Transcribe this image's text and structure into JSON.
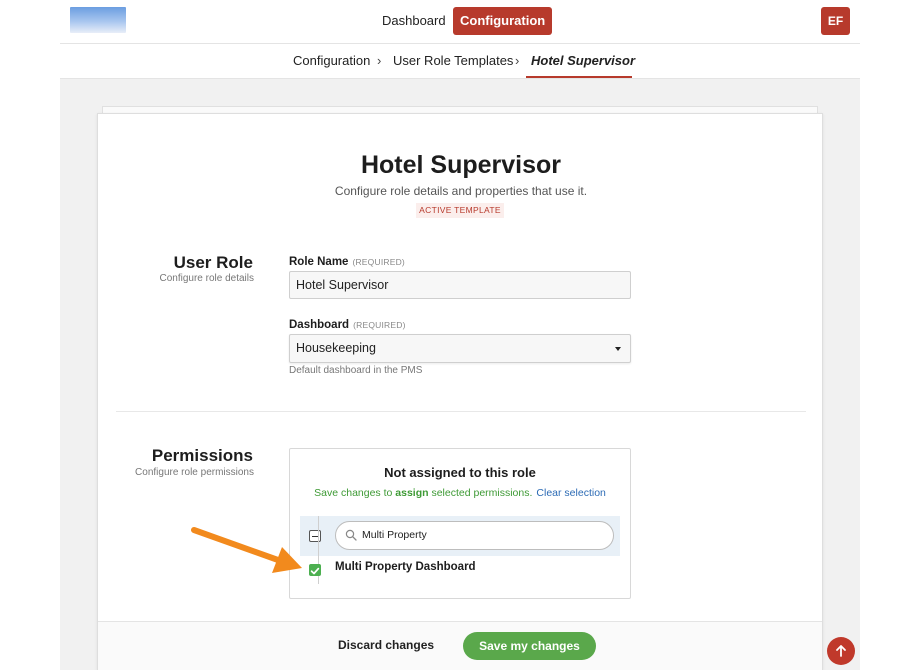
{
  "nav": {
    "dashboard": "Dashboard",
    "configuration": "Configuration",
    "user_initials": "EF"
  },
  "breadcrumb": {
    "items": [
      "Configuration",
      "User Role Templates",
      "Hotel Supervisor"
    ],
    "separator": "›"
  },
  "header": {
    "title": "Hotel Supervisor",
    "subtitle": "Configure role details and properties that use it.",
    "badge": "ACTIVE TEMPLATE"
  },
  "user_role": {
    "title": "User Role",
    "desc": "Configure role details",
    "role_name_label": "Role Name",
    "role_name_required": "(REQUIRED)",
    "role_name_value": "Hotel Supervisor",
    "dashboard_label": "Dashboard",
    "dashboard_required": "(REQUIRED)",
    "dashboard_value": "Housekeeping",
    "dashboard_help": "Default dashboard in the PMS"
  },
  "permissions": {
    "title": "Permissions",
    "desc": "Configure role permissions",
    "box_title": "Not assigned to this role",
    "msg_pre": "Save changes to ",
    "msg_bold": "assign",
    "msg_post": " selected permissions.",
    "clear_link": "Clear selection",
    "search_value": "Multi Property",
    "items": [
      {
        "label": "Multi Property Dashboard",
        "checked": true
      }
    ]
  },
  "footer": {
    "discard": "Discard changes",
    "save": "Save my changes"
  },
  "colors": {
    "brand": "#b73a2c",
    "success": "#5aa84b",
    "annotation_arrow": "#f28a1d",
    "link": "#2c6bb5"
  }
}
